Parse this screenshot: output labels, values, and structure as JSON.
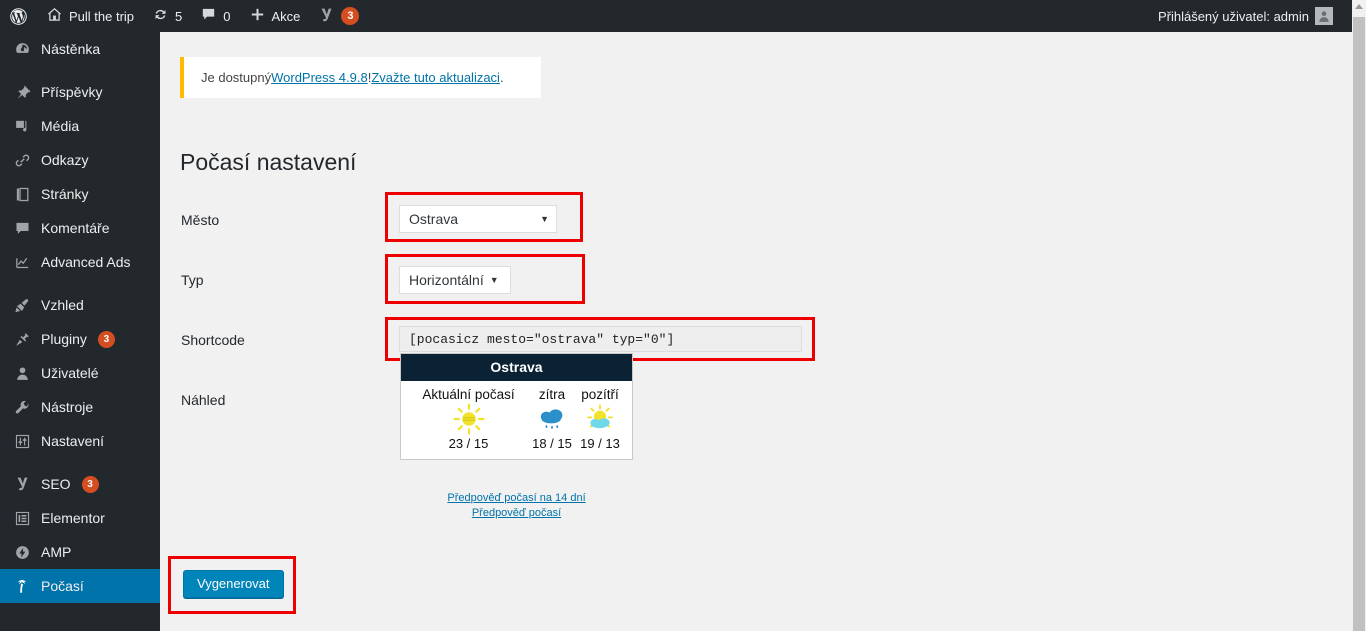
{
  "adminbar": {
    "wp_logo": "wordpress-logo-icon",
    "site_name": "Pull the trip",
    "updates_count": "5",
    "comments_count": "0",
    "new_label": "Akce",
    "yoast_badge": "3",
    "user_greeting": "Přihlášený uživatel: admin"
  },
  "sidebar": {
    "items": [
      {
        "label": "Nástěnka",
        "icon": "dashboard-icon",
        "badge": "",
        "current": false,
        "spaced": false
      },
      {
        "label": "Příspěvky",
        "icon": "pin-icon",
        "badge": "",
        "current": false,
        "spaced": true
      },
      {
        "label": "Média",
        "icon": "media-icon",
        "badge": "",
        "current": false,
        "spaced": false
      },
      {
        "label": "Odkazy",
        "icon": "link-icon",
        "badge": "",
        "current": false,
        "spaced": false
      },
      {
        "label": "Stránky",
        "icon": "page-icon",
        "badge": "",
        "current": false,
        "spaced": false
      },
      {
        "label": "Komentáře",
        "icon": "comment-icon",
        "badge": "",
        "current": false,
        "spaced": false
      },
      {
        "label": "Advanced Ads",
        "icon": "chart-icon",
        "badge": "",
        "current": false,
        "spaced": false
      },
      {
        "label": "Vzhled",
        "icon": "brush-icon",
        "badge": "",
        "current": false,
        "spaced": true
      },
      {
        "label": "Pluginy",
        "icon": "plug-icon",
        "badge": "3",
        "current": false,
        "spaced": false
      },
      {
        "label": "Uživatelé",
        "icon": "user-icon",
        "badge": "",
        "current": false,
        "spaced": false
      },
      {
        "label": "Nástroje",
        "icon": "wrench-icon",
        "badge": "",
        "current": false,
        "spaced": false
      },
      {
        "label": "Nastavení",
        "icon": "settings-icon",
        "badge": "",
        "current": false,
        "spaced": false
      },
      {
        "label": "SEO",
        "icon": "yoast-icon",
        "badge": "3",
        "current": false,
        "spaced": true
      },
      {
        "label": "Elementor",
        "icon": "elementor-icon",
        "badge": "",
        "current": false,
        "spaced": false
      },
      {
        "label": "AMP",
        "icon": "amp-bolt-icon",
        "badge": "",
        "current": false,
        "spaced": false
      },
      {
        "label": "Počasí",
        "icon": "palm-tree-icon",
        "badge": "",
        "current": true,
        "spaced": false
      }
    ]
  },
  "notice": {
    "prefix": "Je dostupný ",
    "link1": "WordPress 4.9.8",
    "middle": "! ",
    "link2": "Zvažte tuto aktualizaci",
    "suffix": "."
  },
  "page": {
    "title": "Počasí nastavení",
    "labels": {
      "city": "Město",
      "type": "Typ",
      "shortcode": "Shortcode",
      "preview": "Náhled"
    },
    "city_value": "Ostrava",
    "type_value": "Horizontální",
    "shortcode_value": "[pocasicz mesto=\"ostrava\" typ=\"0\"]",
    "generate_button": "Vygenerovat"
  },
  "weather": {
    "city": "Ostrava",
    "current_label": "Aktuální počasí",
    "current_temp": "23 / 15",
    "current_icon": "sun-icon",
    "days": [
      {
        "label": "zítra",
        "icon": "rain-cloud-icon",
        "temp": "18 / 15"
      },
      {
        "label": "pozítří",
        "icon": "sun-behind-cloud-icon",
        "temp": "19 / 13"
      }
    ],
    "link_14days": "Předpověď počasí na 14 dní",
    "link_forecast": "Předpověď počasí"
  },
  "colors": {
    "admin_dark": "#23282d",
    "accent_blue": "#0073aa",
    "button_blue": "#0085ba",
    "highlight_red": "#ee0000",
    "notice_yellow": "#ffb900",
    "badge_orange": "#d54e21",
    "widget_header": "#0a2233",
    "sun_yellow": "#f2e32a",
    "cloud_blue": "#2b8fc9"
  }
}
